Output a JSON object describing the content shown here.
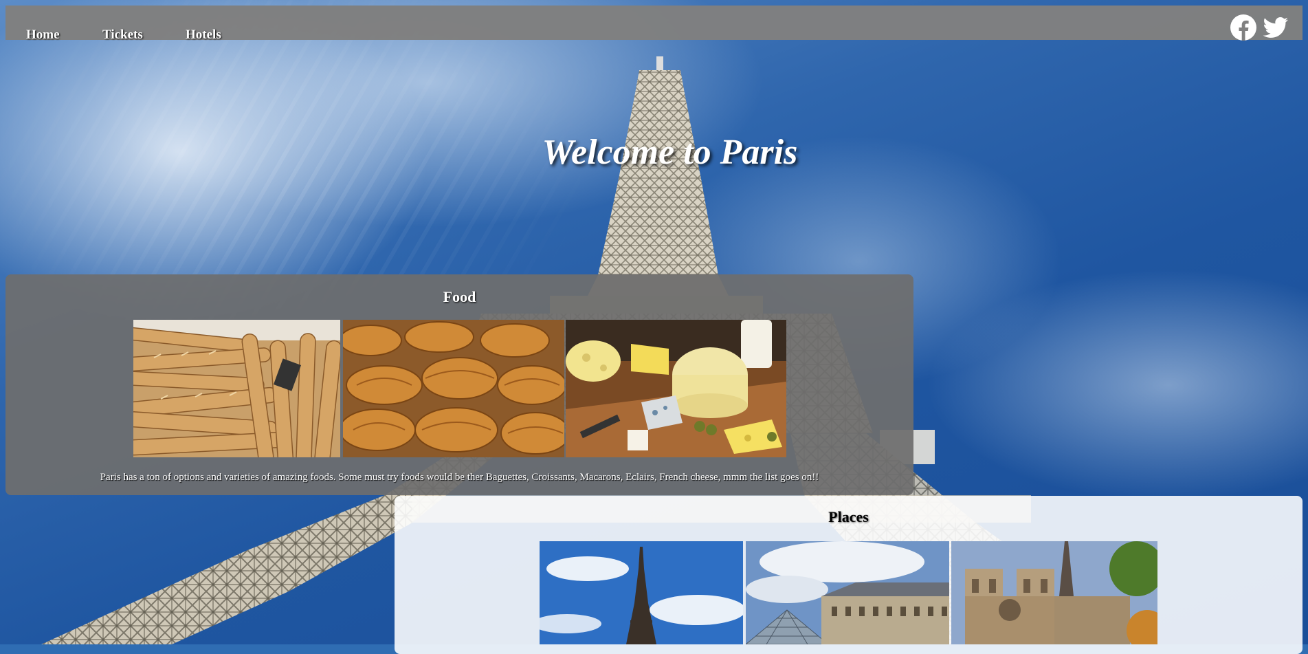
{
  "nav": {
    "items": [
      {
        "label": "Home"
      },
      {
        "label": "Tickets"
      },
      {
        "label": "Hotels"
      }
    ],
    "social": [
      {
        "icon": "facebook-icon"
      },
      {
        "icon": "twitter-icon"
      }
    ]
  },
  "hero": {
    "title": "Welcome to Paris"
  },
  "food": {
    "title": "Food",
    "images": [
      "baguettes",
      "croissants",
      "cheese"
    ],
    "description": "Paris has a ton of options and varieties of amazing foods. Some must try foods would be ther Baguettes, Croissants, Macarons, Eclairs, French cheese, mmm the list goes on!!"
  },
  "places": {
    "title": "Places",
    "images": [
      "eiffel-tower",
      "louvre",
      "notre-dame"
    ]
  },
  "colors": {
    "nav_bg": "#808080",
    "text_light": "#ffffff",
    "sky": "#2f66ad"
  }
}
